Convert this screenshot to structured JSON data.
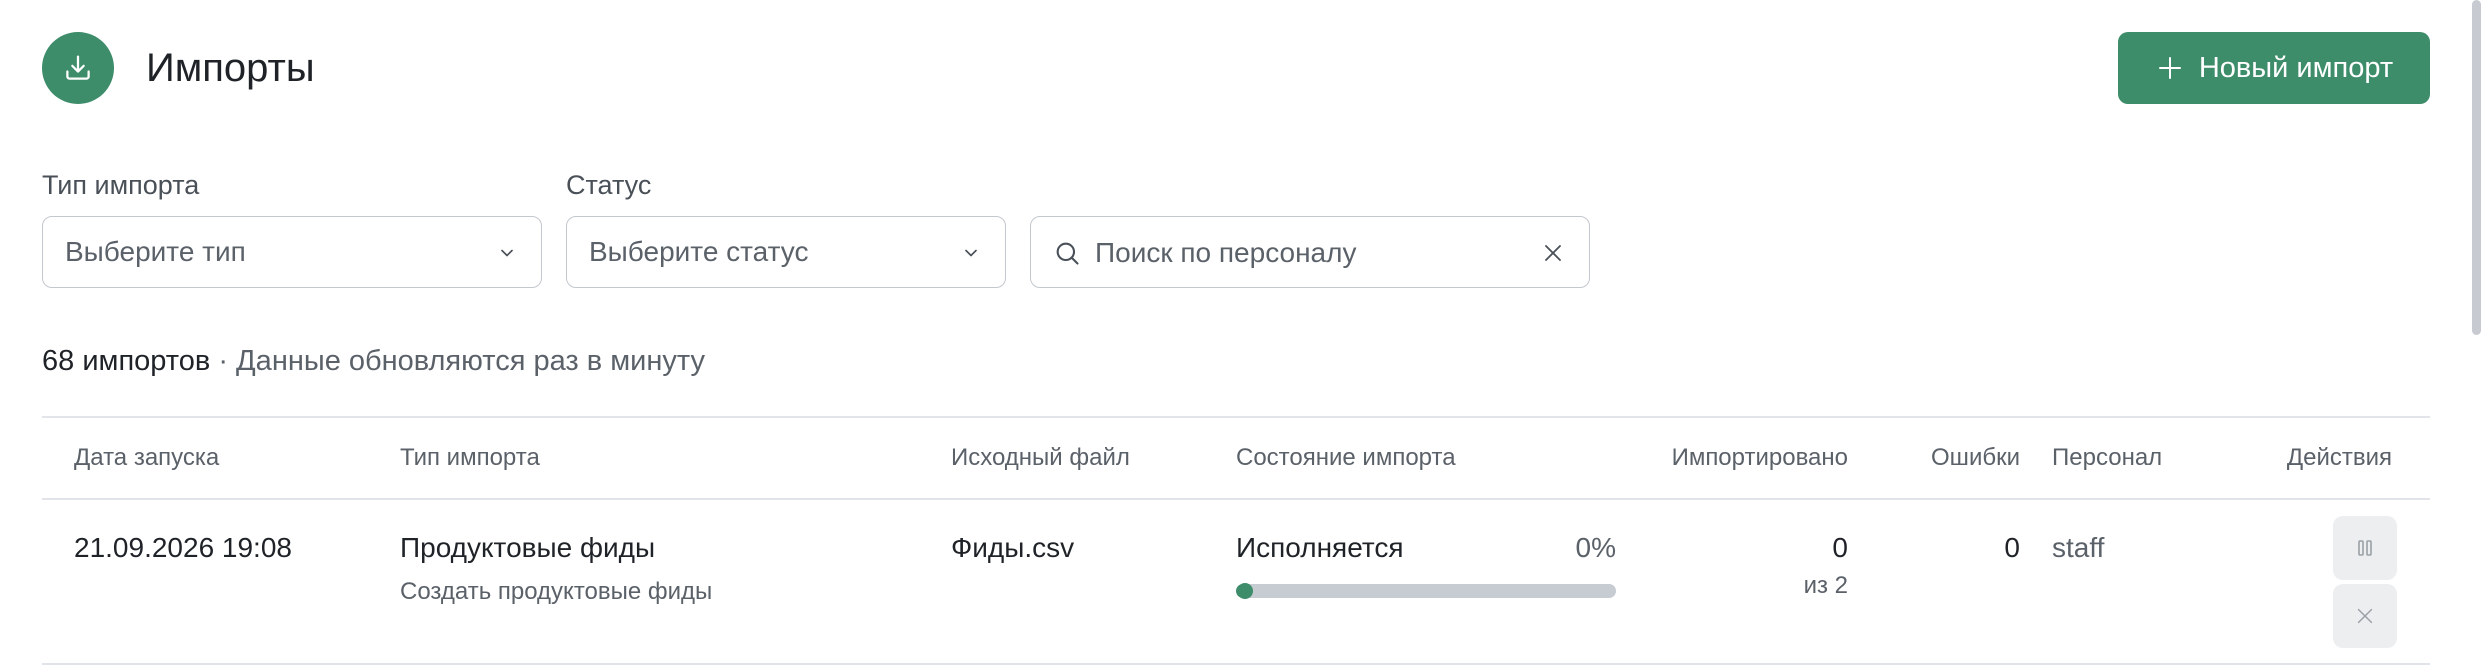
{
  "header": {
    "title": "Импорты",
    "icon": "download-icon",
    "new_import_label": "Новый импорт",
    "new_import_icon": "plus-icon"
  },
  "filters": {
    "type_label": "Тип импорта",
    "type_placeholder": "Выберите тип",
    "status_label": "Статус",
    "status_placeholder": "Выберите статус",
    "search_placeholder": "Поиск по персоналу"
  },
  "summary": {
    "count": "68 импортов",
    "separator": " · ",
    "note": "Данные обновляются раз в минуту"
  },
  "table": {
    "columns": [
      "Дата запуска",
      "Тип импорта",
      "Исходный файл",
      "Состояние импорта",
      "Импортировано",
      "Ошибки",
      "Персонал",
      "Действия"
    ],
    "rows": [
      {
        "date": "21.09.2026 19:08",
        "type": "Продуктовые фиды",
        "type_sub": "Создать продуктовые фиды",
        "file": "Фиды.csv",
        "state": "Исполняется",
        "progress_label": "0%",
        "progress": 0,
        "imported": "0",
        "imported_sub": "из 2",
        "errors": "0",
        "staff": "staff",
        "actions": [
          "pause-icon",
          "close-icon"
        ]
      }
    ]
  },
  "colors": {
    "accent": "#3d8c6a",
    "track": "#c6ccd2",
    "border": "#c3c8ce",
    "muted_text": "#5b6169"
  }
}
